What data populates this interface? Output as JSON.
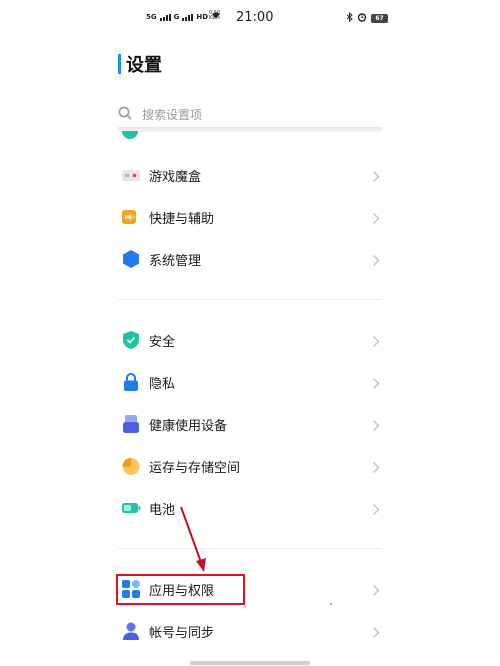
{
  "status_bar": {
    "sim1": "5G",
    "sim2": "G",
    "hd": "HD",
    "net_speed_value": "0.50",
    "net_speed_unit": "KB/s",
    "time": "21:00",
    "battery": "67"
  },
  "header": {
    "title": "设置"
  },
  "search": {
    "placeholder": "搜索设置项"
  },
  "sections": [
    {
      "items": [
        {
          "label": "游戏魔盒",
          "icon": "game-box-icon"
        },
        {
          "label": "快捷与辅助",
          "icon": "shortcut-arrow-icon"
        },
        {
          "label": "系统管理",
          "icon": "system-hexagon-icon"
        }
      ]
    },
    {
      "items": [
        {
          "label": "安全",
          "icon": "shield-icon"
        },
        {
          "label": "隐私",
          "icon": "lock-icon"
        },
        {
          "label": "健康使用设备",
          "icon": "wellbeing-icon"
        },
        {
          "label": "运存与存储空间",
          "icon": "storage-pie-icon"
        },
        {
          "label": "电池",
          "icon": "battery-icon"
        }
      ]
    },
    {
      "items": [
        {
          "label": "应用与权限",
          "icon": "apps-grid-icon"
        },
        {
          "label": "帐号与同步",
          "icon": "account-icon"
        }
      ]
    }
  ],
  "annotation": {
    "highlight_color": "#d9142b",
    "highlighted_item": "应用与权限"
  },
  "colors": {
    "accent": "#1e8fe6"
  }
}
